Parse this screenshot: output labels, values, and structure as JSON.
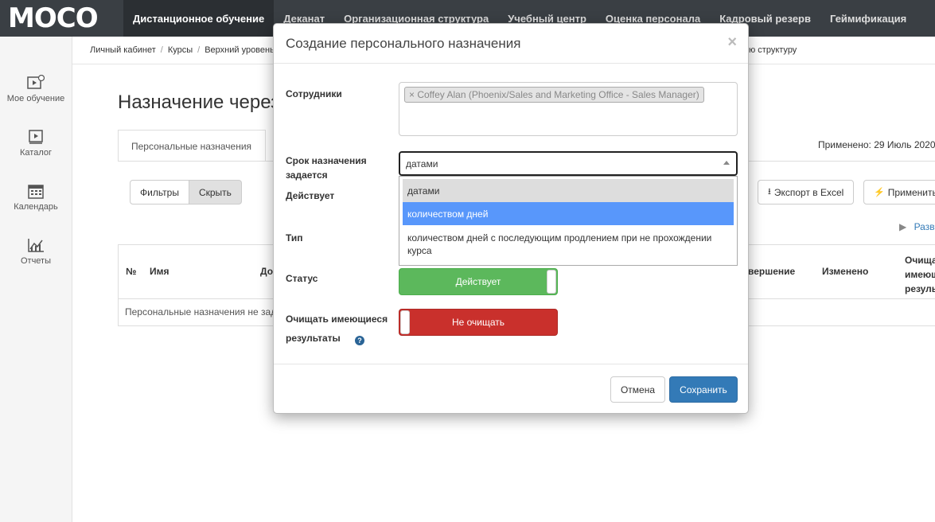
{
  "logo": "MOCO",
  "nav": [
    "Дистанционное обучение",
    "Деканат",
    "Организационная структура",
    "Учебный центр",
    "Оценка персонала",
    "Кадровый резерв",
    "Геймификация"
  ],
  "sidebar": {
    "items": [
      {
        "label": "Мое обучение",
        "icon": "my-learning-icon"
      },
      {
        "label": "Каталог",
        "icon": "catalog-icon"
      },
      {
        "label": "Календарь",
        "icon": "calendar-icon"
      },
      {
        "label": "Отчеты",
        "icon": "reports-icon"
      }
    ]
  },
  "breadcrumb": {
    "items": [
      "Личный кабинет",
      "Курсы",
      "Верхний уровень"
    ],
    "tail": "ю структуру"
  },
  "page": {
    "title": "Назначение через",
    "tab_label": "Персональные назначения",
    "applied": "Применено: 29 Июль 2020",
    "filters_button": "Фильтры",
    "hide_button": "Скрыть",
    "export_button": "Экспорт в Excel",
    "apply_button": "Применить в",
    "expand_link": "Разв",
    "table": {
      "headers": [
        "№",
        "Имя",
        "До",
        "вершение",
        "Изменено"
      ],
      "clear_header": [
        "Очища",
        "имеющ",
        "резуль"
      ],
      "empty_text": "Персональные назначения не зад"
    }
  },
  "modal": {
    "title": "Создание персонального назначения",
    "close": "×",
    "employees_label": "Сотрудники",
    "employee_tag": "× Coffey Alan (Phoenix/Sales and Marketing Office - Sales Manager)",
    "term_label_1": "Срок назначения",
    "term_label_2": "задается",
    "term_value": "датами",
    "term_options": [
      "датами",
      "количеством дней",
      "количеством дней с последующим продлением при не прохождении",
      "курса"
    ],
    "active_label": "Действует",
    "type_label": "Тип",
    "status_label": "Статус",
    "status_value": "Действует",
    "clear_label_1": "Очищать имеющиеся",
    "clear_label_2": "результаты",
    "clear_value": "Не очищать",
    "help": "?",
    "cancel_button": "Отмена",
    "save_button": "Сохранить"
  },
  "colors": {
    "navbar": "#3a3f44",
    "primary": "#337ab7",
    "success": "#5cb85c",
    "danger": "#c9302c",
    "highlight": "#5897fb"
  }
}
